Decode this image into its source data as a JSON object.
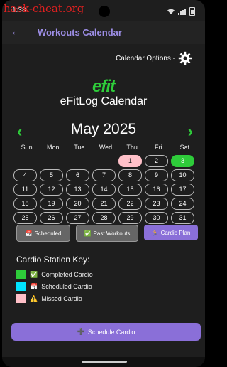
{
  "status": {
    "time": "1:38",
    "watermark": "hack-cheat.org"
  },
  "appbar": {
    "title": "Workouts Calendar"
  },
  "calendar_options": {
    "label": "Calendar Options -"
  },
  "brand": {
    "logo": "efit",
    "title": "eFitLog Calendar"
  },
  "month": {
    "label": "May 2025",
    "prev": "‹",
    "next": "›"
  },
  "weekdays": [
    "Sun",
    "Mon",
    "Tue",
    "Wed",
    "Thu",
    "Fri",
    "Sat"
  ],
  "days": [
    {
      "n": "",
      "s": "empty"
    },
    {
      "n": "",
      "s": "empty"
    },
    {
      "n": "",
      "s": "empty"
    },
    {
      "n": "",
      "s": "empty"
    },
    {
      "n": "1",
      "s": "pink"
    },
    {
      "n": "2",
      "s": ""
    },
    {
      "n": "3",
      "s": "green"
    },
    {
      "n": "4",
      "s": ""
    },
    {
      "n": "5",
      "s": ""
    },
    {
      "n": "6",
      "s": ""
    },
    {
      "n": "7",
      "s": ""
    },
    {
      "n": "8",
      "s": ""
    },
    {
      "n": "9",
      "s": ""
    },
    {
      "n": "10",
      "s": ""
    },
    {
      "n": "11",
      "s": ""
    },
    {
      "n": "12",
      "s": ""
    },
    {
      "n": "13",
      "s": ""
    },
    {
      "n": "14",
      "s": ""
    },
    {
      "n": "15",
      "s": ""
    },
    {
      "n": "16",
      "s": ""
    },
    {
      "n": "17",
      "s": ""
    },
    {
      "n": "18",
      "s": ""
    },
    {
      "n": "19",
      "s": ""
    },
    {
      "n": "20",
      "s": ""
    },
    {
      "n": "21",
      "s": ""
    },
    {
      "n": "22",
      "s": ""
    },
    {
      "n": "23",
      "s": ""
    },
    {
      "n": "24",
      "s": ""
    },
    {
      "n": "25",
      "s": ""
    },
    {
      "n": "26",
      "s": ""
    },
    {
      "n": "27",
      "s": ""
    },
    {
      "n": "28",
      "s": ""
    },
    {
      "n": "29",
      "s": ""
    },
    {
      "n": "30",
      "s": ""
    },
    {
      "n": "31",
      "s": ""
    }
  ],
  "filters": {
    "scheduled": {
      "icon": "📅",
      "label": "Scheduled"
    },
    "past": {
      "icon": "✅",
      "label": "Past Workouts"
    },
    "cardio": {
      "icon": "🏃",
      "label": "Cardio Plan"
    }
  },
  "key": {
    "title": "Cardio Station Key:",
    "completed": {
      "icon": "✅",
      "label": "Completed Cardio",
      "color": "#2ecc3a"
    },
    "scheduled": {
      "icon": "📅",
      "label": "Scheduled Cardio",
      "color": "#00e5ff"
    },
    "missed": {
      "icon": "⚠️",
      "label": "Missed Cardio",
      "color": "#ffc0c8"
    }
  },
  "schedule_button": {
    "icon": "➕",
    "label": "Schedule Cardio"
  },
  "colors": {
    "accent": "#8a6fd8",
    "brand": "#2ecc3a",
    "title": "#9d8ee6"
  }
}
